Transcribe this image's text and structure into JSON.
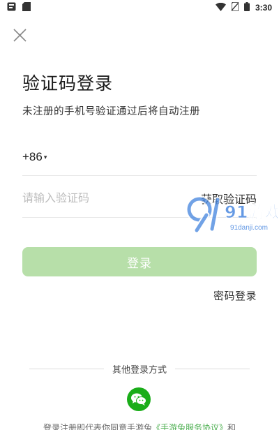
{
  "status_bar": {
    "time": "3:30",
    "icons_left": [
      "notification-icon",
      "sd-card-icon"
    ],
    "icons_right": [
      "wifi-icon",
      "no-sim-icon",
      "battery-icon"
    ]
  },
  "login": {
    "title": "验证码登录",
    "subtitle": "未注册的手机号验证通过后将自动注册",
    "country_code": "+86",
    "phone_value": "",
    "code_placeholder": "请输入验证码",
    "get_code_label": "获取验证码",
    "login_button": "登录",
    "password_login": "密码登录",
    "other_login_methods": "其他登录方式",
    "agreement_prefix": "登录注册即代表你同意手游兔",
    "agreement_link": "《手游兔服务协议》",
    "agreement_suffix": "和"
  },
  "watermark": {
    "logo_text": "91游戏",
    "url_text": "91danji.com"
  },
  "colors": {
    "primary_green": "#b7dfa9",
    "wechat_green": "#1aad19",
    "link_green": "#4caf50"
  }
}
